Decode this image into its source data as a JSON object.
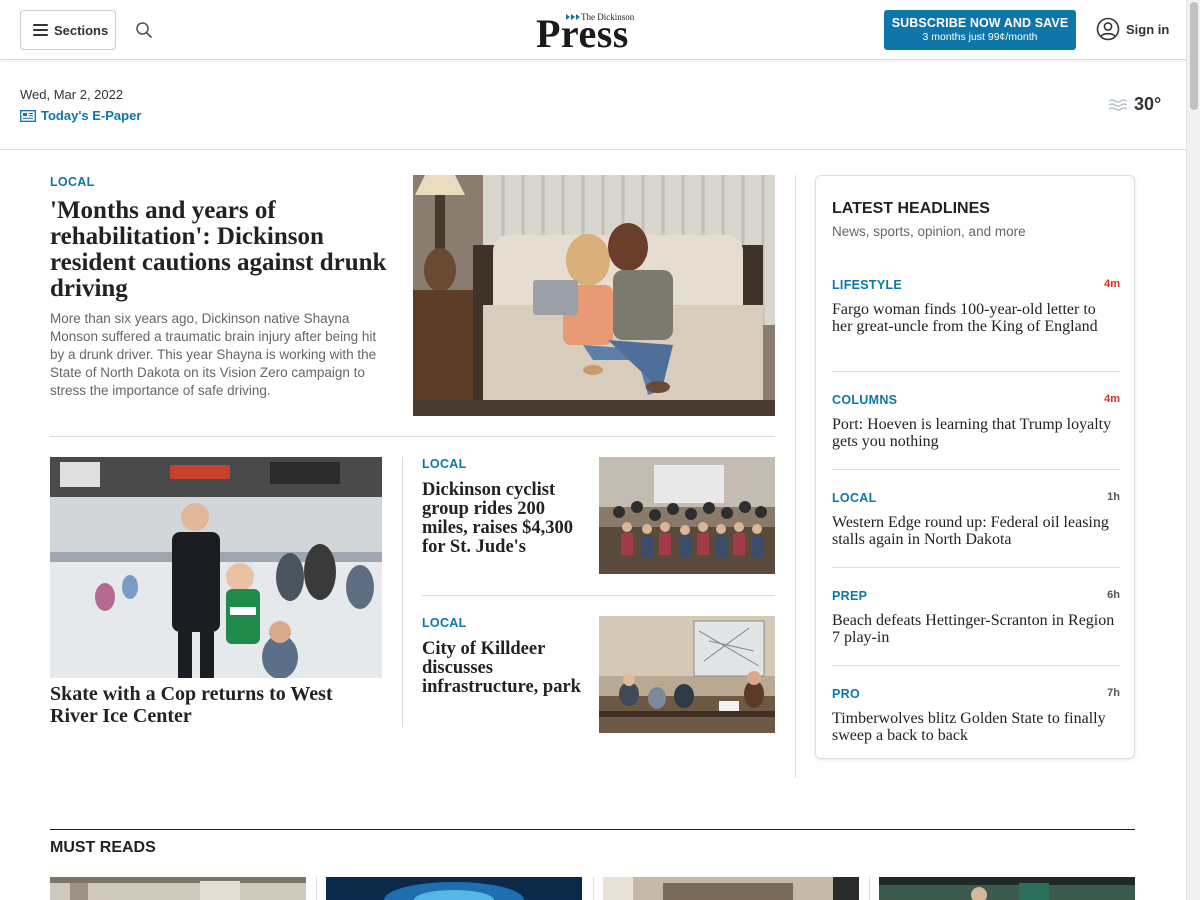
{
  "header": {
    "sections_label": "Sections",
    "logo_small": "The Dickinson",
    "logo_big": "Press",
    "subscribe_main": "SUBSCRIBE NOW AND SAVE",
    "subscribe_sub": "3 months just 99¢/month",
    "signin_label": "Sign in"
  },
  "datebar": {
    "date": "Wed, Mar 2, 2022",
    "epaper_label": "Today's E-Paper",
    "temperature": "30°"
  },
  "lead": {
    "kicker": "LOCAL",
    "headline": "'Months and years of rehabilitation': Dickinson resident cautions against drunk driving",
    "summary": "More than six years ago, Dickinson native Shayna Monson suffered a traumatic brain injury after being hit by a drunk driver. This year Shayna is working with the State of North Dakota on its Vision Zero campaign to stress the importance of safe driving."
  },
  "secondary": [
    {
      "headline": "Skate with a Cop returns to West River Ice Center"
    },
    {
      "kicker": "LOCAL",
      "headline": "Dickinson cyclist group rides 200 miles, raises $4,300 for St. Jude's"
    },
    {
      "kicker": "LOCAL",
      "headline": "City of Killdeer discusses infrastructure, park"
    }
  ],
  "latest": {
    "title": "LATEST HEADLINES",
    "subtitle": "News, sports, opinion, and more",
    "items": [
      {
        "kicker": "LIFESTYLE",
        "time": "4m",
        "headline": "Fargo woman finds 100-year-old letter to her great-uncle from the King of England"
      },
      {
        "kicker": "COLUMNS",
        "time": "4m",
        "headline": "Port: Hoeven is learning that Trump loyalty gets you nothing"
      },
      {
        "kicker": "LOCAL",
        "time": "1h",
        "headline": "Western Edge round up: Federal oil leasing stalls again in North Dakota"
      },
      {
        "kicker": "PREP",
        "time": "6h",
        "headline": "Beach defeats Hettinger-Scranton in Region 7 play-in"
      },
      {
        "kicker": "PRO",
        "time": "7h",
        "headline": "Timberwolves blitz Golden State to finally sweep a back to back"
      }
    ]
  },
  "must_reads": {
    "title": "MUST READS"
  },
  "colors": {
    "accent": "#0e76a8",
    "recent_time": "#d93025",
    "old_time": "#555555"
  },
  "icons": [
    "hamburger-icon",
    "search-icon",
    "user-icon",
    "newspaper-icon",
    "fog-icon"
  ]
}
